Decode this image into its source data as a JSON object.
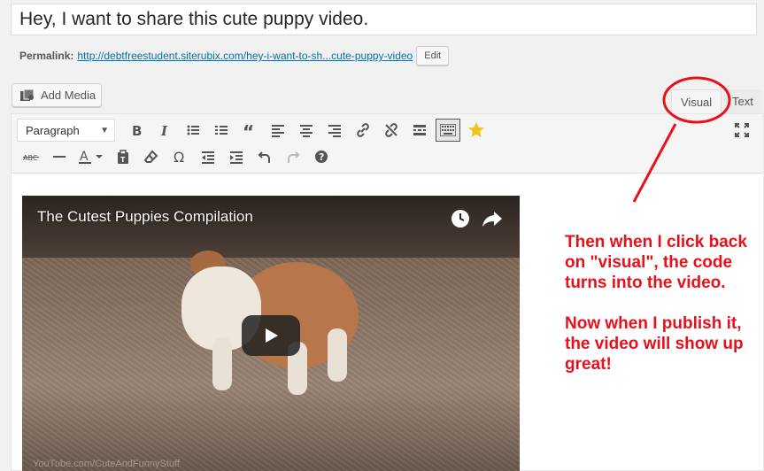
{
  "post": {
    "title": "Hey, I want to share this cute puppy video.",
    "permalink_label": "Permalink:",
    "permalink_base": "http://debtfreestudent.siterubix.com/",
    "permalink_slug": "hey-i-want-to-sh...cute-puppy-video",
    "edit_label": "Edit"
  },
  "media": {
    "add_media_label": "Add Media"
  },
  "tabs": {
    "visual": "Visual",
    "text": "Text"
  },
  "toolbar": {
    "format_value": "Paragraph"
  },
  "video": {
    "title": "The Cutest Puppies Compilation",
    "watermark": "YouTube.com/CuteAndFunnyStuff"
  },
  "annotation": {
    "text": "Then when I click back on \"visual\", the code turns into the video.\n\nNow when I publish it, the video will show up great!"
  },
  "colors": {
    "annotation": "#e8111b",
    "link": "#0073aa"
  }
}
